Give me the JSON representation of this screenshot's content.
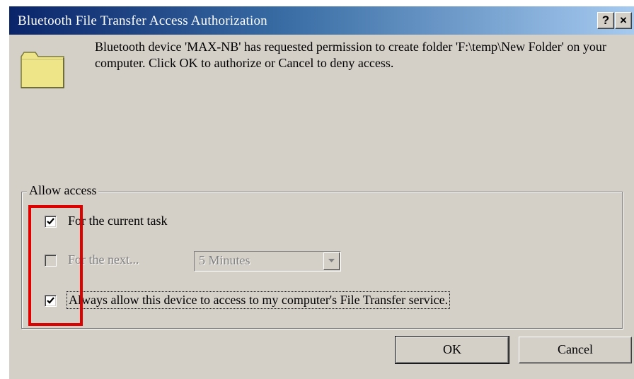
{
  "window": {
    "title": "Bluetooth File Transfer Access Authorization",
    "help_button": "?",
    "close_button": "×"
  },
  "message": "Bluetooth device 'MAX-NB' has requested permission to create folder 'F:\\temp\\New Folder' on your computer.  Click OK to authorize or Cancel to deny access.",
  "allow_access": {
    "legend": "Allow access",
    "options": [
      {
        "label": "For the current task",
        "checked": true,
        "enabled": true
      },
      {
        "label": "For the next...",
        "checked": false,
        "enabled": false
      },
      {
        "label": "Always allow this device to access to my computer's File Transfer service.",
        "checked": true,
        "enabled": true
      }
    ],
    "duration_select": {
      "value": "5 Minutes",
      "enabled": false
    }
  },
  "buttons": {
    "ok": "OK",
    "cancel": "Cancel"
  },
  "colors": {
    "highlight": "#e00000",
    "face": "#d4d0c8",
    "title_start": "#0a246a",
    "folder": "#ede587"
  },
  "icons": {
    "folder": "folder-icon",
    "check": "checkmark-icon",
    "dropdown": "chevron-down-icon"
  }
}
